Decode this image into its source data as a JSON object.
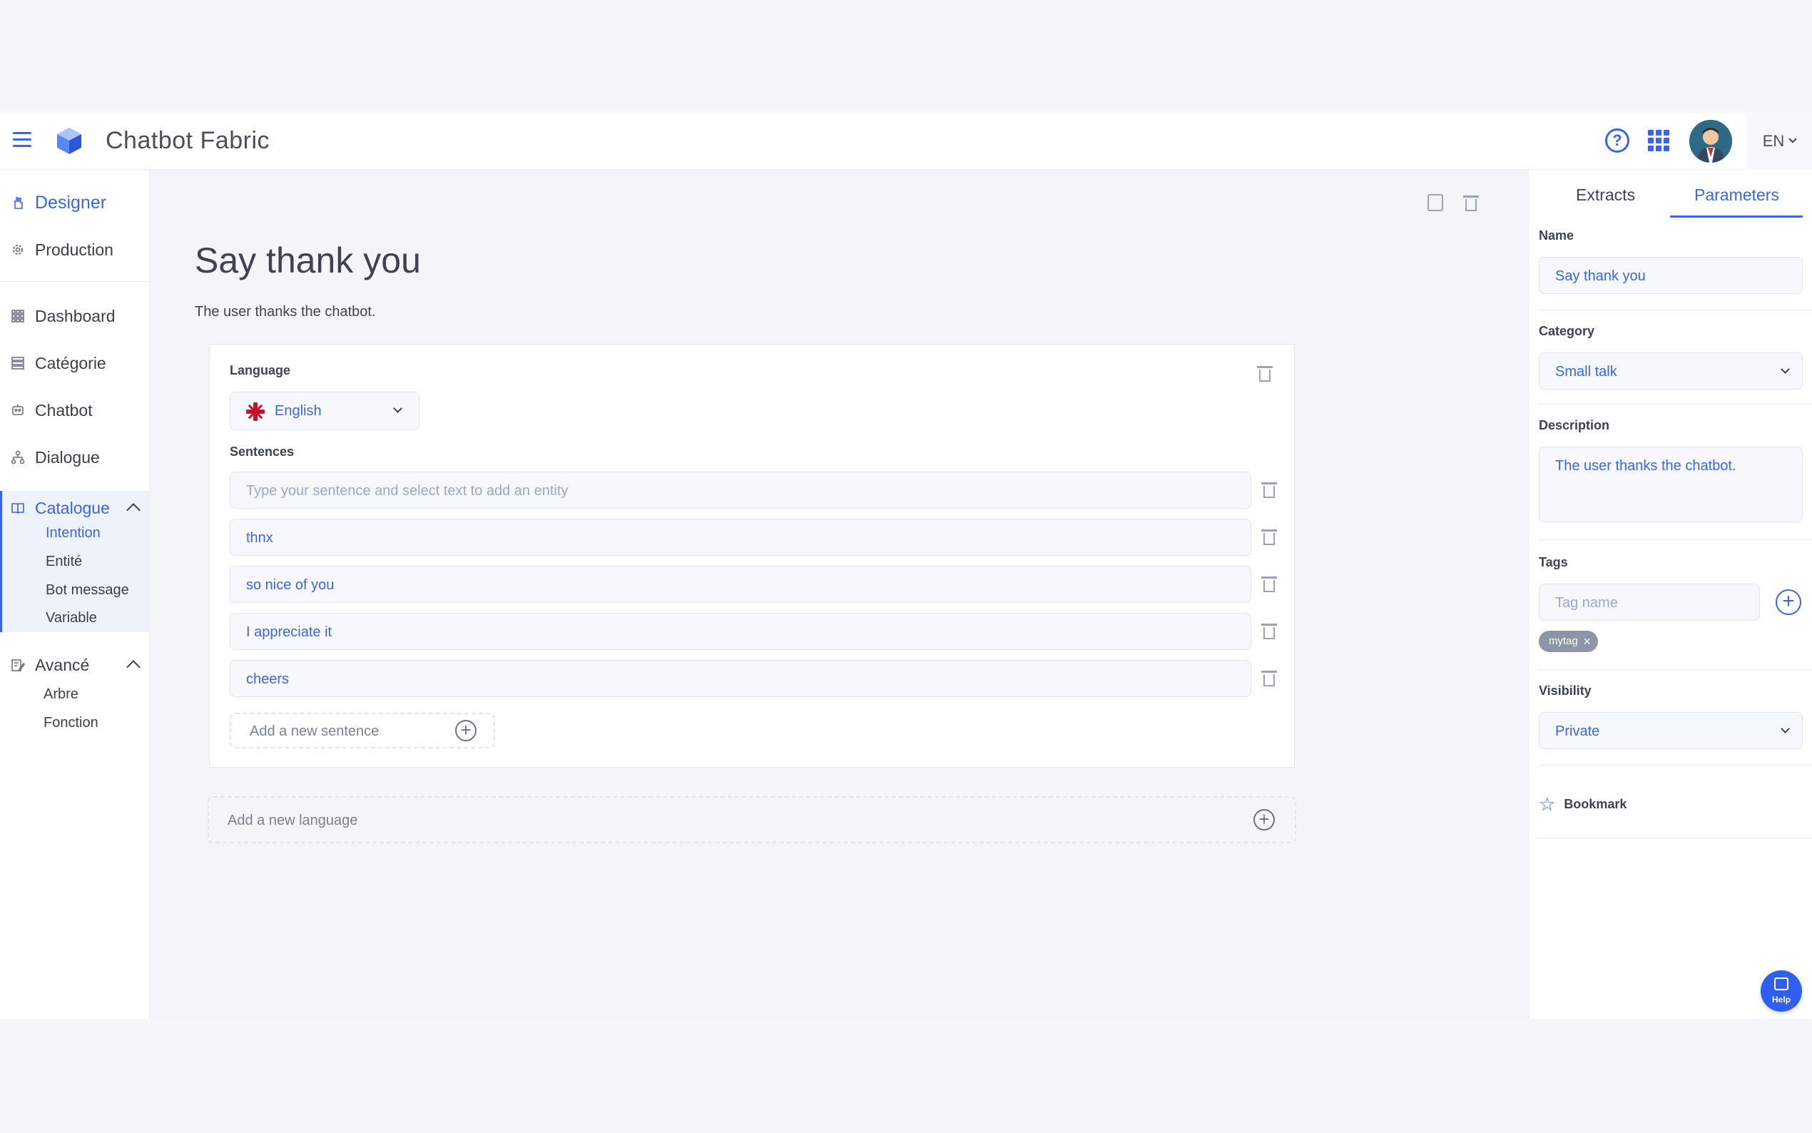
{
  "app": {
    "title": "Chatbot Fabric",
    "language_switch": "EN"
  },
  "icons": {
    "menu": "hamburger-icon",
    "logo": "cube-logo-icon",
    "help": "question-circle-icon",
    "apps": "grid-icon",
    "avatar": "user-avatar",
    "save": "save-icon",
    "delete": "trash-icon",
    "add": "plus-circle-icon",
    "bookmark": "star-icon",
    "flag": "uk-flag-icon"
  },
  "colors": {
    "accent": "#3a63f0",
    "tag_chip": "#8d96a8",
    "help_fab": "#2f5ef0"
  },
  "sidebar": {
    "top_items": [
      {
        "label": "Designer",
        "icon": "hand-icon",
        "active": true
      },
      {
        "label": "Production",
        "icon": "gear-icon"
      }
    ],
    "items": [
      {
        "label": "Dashboard",
        "icon": "dashboard-icon"
      },
      {
        "label": "Catégorie",
        "icon": "list-icon"
      },
      {
        "label": "Chatbot",
        "icon": "robot-icon"
      },
      {
        "label": "Dialogue",
        "icon": "tree-icon"
      }
    ],
    "catalogue": {
      "label": "Catalogue",
      "icon": "book-icon",
      "expanded": true,
      "items": [
        {
          "label": "Intention",
          "active": true
        },
        {
          "label": "Entité"
        },
        {
          "label": "Bot message"
        },
        {
          "label": "Variable"
        }
      ]
    },
    "advanced": {
      "label": "Avancé",
      "icon": "edit-doc-icon",
      "expanded": true,
      "items": [
        {
          "label": "Arbre"
        },
        {
          "label": "Fonction"
        }
      ]
    }
  },
  "main": {
    "title": "Say thank you",
    "description": "The user thanks the chatbot.",
    "language_card": {
      "language_label": "Language",
      "language_value": "English",
      "sentences_label": "Sentences",
      "sentence_placeholder": "Type your sentence and select text to add an entity",
      "sentences": [
        "thnx",
        "so nice of you",
        "I appreciate it",
        "cheers"
      ],
      "add_sentence": "Add a new sentence"
    },
    "add_language": "Add a new language"
  },
  "panel": {
    "tabs": [
      {
        "label": "Extracts"
      },
      {
        "label": "Parameters",
        "active": true
      }
    ],
    "name_label": "Name",
    "name_value": "Say thank you",
    "category_label": "Category",
    "category_value": "Small talk",
    "description_label": "Description",
    "description_value": "The user thanks the chatbot.",
    "tags_label": "Tags",
    "tag_placeholder": "Tag name",
    "tags": [
      "mytag"
    ],
    "visibility_label": "Visibility",
    "visibility_value": "Private",
    "bookmark_label": "Bookmark"
  },
  "help_fab": {
    "label": "Help"
  }
}
